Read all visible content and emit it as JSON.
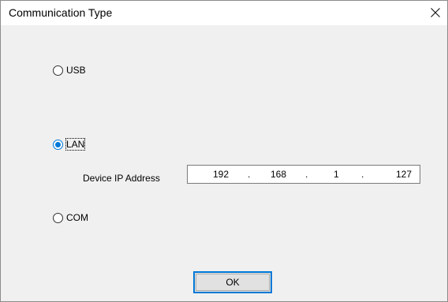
{
  "window": {
    "title": "Communication Type"
  },
  "options": {
    "usb": {
      "label": "USB",
      "checked": false
    },
    "lan": {
      "label": "LAN",
      "checked": true
    },
    "com": {
      "label": "COM",
      "checked": false
    }
  },
  "ip": {
    "label": "Device IP Address",
    "octets": [
      "192",
      "168",
      "1",
      "127"
    ],
    "separator": "."
  },
  "buttons": {
    "ok_label": "OK"
  },
  "colors": {
    "accent": "#0078d7",
    "client_background": "#f0f0f0"
  },
  "icons": {
    "close": "close-icon"
  }
}
